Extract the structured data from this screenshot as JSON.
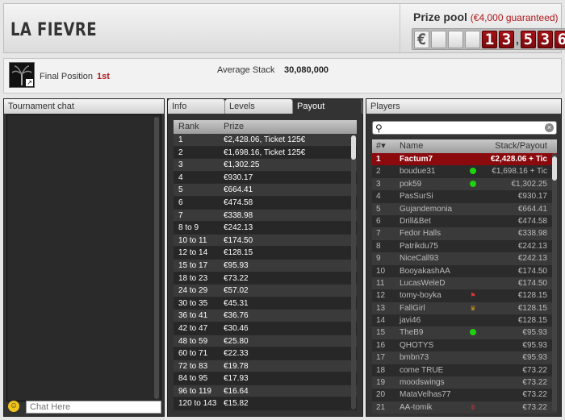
{
  "header": {
    "title": "LA FIEVRE",
    "prize_pool_label": "Prize pool",
    "prize_pool_guarantee": "(€4,000 guaranteed)",
    "odometer": {
      "currency": "€",
      "digits_left": [
        "1",
        "3"
      ],
      "comma": ",",
      "digits_right": [
        "5",
        "3",
        "6"
      ]
    }
  },
  "info": {
    "final_position_label": "Final Position",
    "final_position_value": "1st",
    "average_stack_label": "Average Stack",
    "average_stack_value": "30,080,000"
  },
  "chat": {
    "title": "Tournament chat",
    "input_placeholder": "Chat Here"
  },
  "tabs": {
    "info": "Info",
    "levels": "Levels",
    "payout": "Payout",
    "active": "Payout"
  },
  "payout": {
    "headers": {
      "rank": "Rank",
      "prize": "Prize"
    },
    "rows": [
      {
        "rank": "1",
        "prize": "€2,428.06, Ticket 125€"
      },
      {
        "rank": "2",
        "prize": "€1,698.16, Ticket 125€"
      },
      {
        "rank": "3",
        "prize": "€1,302.25"
      },
      {
        "rank": "4",
        "prize": "€930.17"
      },
      {
        "rank": "5",
        "prize": "€664.41"
      },
      {
        "rank": "6",
        "prize": "€474.58"
      },
      {
        "rank": "7",
        "prize": "€338.98"
      },
      {
        "rank": "8 to 9",
        "prize": "€242.13"
      },
      {
        "rank": "10 to 11",
        "prize": "€174.50"
      },
      {
        "rank": "12 to 14",
        "prize": "€128.15"
      },
      {
        "rank": "15 to 17",
        "prize": "€95.93"
      },
      {
        "rank": "18 to 23",
        "prize": "€73.22"
      },
      {
        "rank": "24 to 29",
        "prize": "€57.02"
      },
      {
        "rank": "30 to 35",
        "prize": "€45.31"
      },
      {
        "rank": "36 to 41",
        "prize": "€36.76"
      },
      {
        "rank": "42 to 47",
        "prize": "€30.46"
      },
      {
        "rank": "48 to 59",
        "prize": "€25.80"
      },
      {
        "rank": "60 to 71",
        "prize": "€22.33"
      },
      {
        "rank": "72 to 83",
        "prize": "€19.78"
      },
      {
        "rank": "84 to 95",
        "prize": "€17.93"
      },
      {
        "rank": "96 to 119",
        "prize": "€16.64"
      },
      {
        "rank": "120 to 143",
        "prize": "€15.82"
      }
    ]
  },
  "players": {
    "title": "Players",
    "headers": {
      "num": "#▾",
      "name": "Name",
      "stack": "Stack/Payout"
    },
    "rows": [
      {
        "num": "1",
        "name": "Factum7",
        "icon": "",
        "stack": "€2,428.06 + Tic",
        "highlight": true
      },
      {
        "num": "2",
        "name": "boudue31",
        "icon": "online-dot",
        "stack": "€1,698.16 + Tic"
      },
      {
        "num": "3",
        "name": "pok59",
        "icon": "online-dot",
        "stack": "€1,302.25"
      },
      {
        "num": "4",
        "name": "PasSurSi",
        "icon": "",
        "stack": "€930.17"
      },
      {
        "num": "5",
        "name": "Gujandemonia",
        "icon": "",
        "stack": "€664.41"
      },
      {
        "num": "6",
        "name": "Drill&Bet",
        "icon": "",
        "stack": "€474.58"
      },
      {
        "num": "7",
        "name": "Fedor Halls",
        "icon": "",
        "stack": "€338.98"
      },
      {
        "num": "8",
        "name": "Patrikdu75",
        "icon": "",
        "stack": "€242.13"
      },
      {
        "num": "9",
        "name": "NiceCall93",
        "icon": "",
        "stack": "€242.13"
      },
      {
        "num": "10",
        "name": "BooyakashAA",
        "icon": "",
        "stack": "€174.50"
      },
      {
        "num": "11",
        "name": "LucasWeleD",
        "icon": "",
        "stack": "€174.50"
      },
      {
        "num": "12",
        "name": "tomy-boyka",
        "icon": "flag",
        "stack": "€128.15"
      },
      {
        "num": "13",
        "name": "FallGirl",
        "icon": "crown",
        "stack": "€128.15"
      },
      {
        "num": "14",
        "name": "javi46",
        "icon": "",
        "stack": "€128.15"
      },
      {
        "num": "15",
        "name": "TheB9",
        "icon": "online-dot",
        "stack": "€95.93"
      },
      {
        "num": "16",
        "name": "QHOTYS",
        "icon": "",
        "stack": "€95.93"
      },
      {
        "num": "17",
        "name": "bmbn73",
        "icon": "",
        "stack": "€95.93"
      },
      {
        "num": "18",
        "name": "come TRUE",
        "icon": "",
        "stack": "€73.22"
      },
      {
        "num": "19",
        "name": "moodswings",
        "icon": "",
        "stack": "€73.22"
      },
      {
        "num": "20",
        "name": "MataVelhas77",
        "icon": "",
        "stack": "€73.22"
      },
      {
        "num": "21",
        "name": "AA-tomik",
        "icon": "badge",
        "stack": "€73.22"
      }
    ]
  },
  "colors": {
    "accent_red": "#b0171b",
    "highlight_row": "#8a0a0e",
    "online": "#1fd20f"
  }
}
